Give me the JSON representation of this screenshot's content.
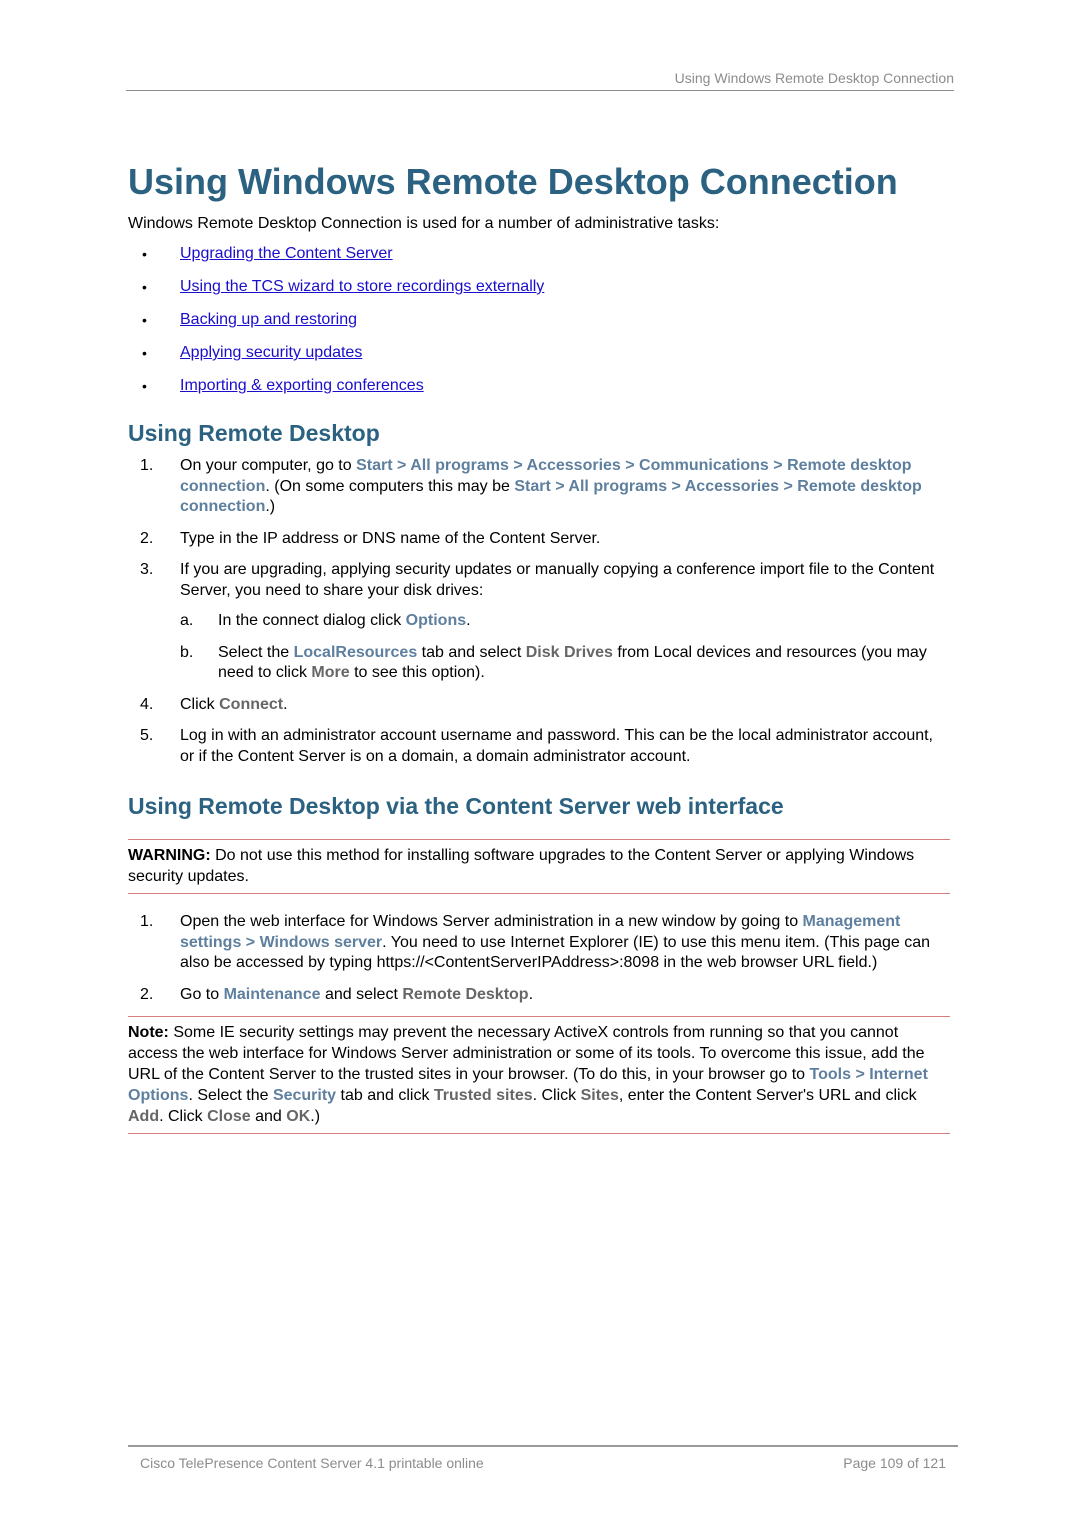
{
  "header": {
    "running_title": "Using Windows Remote Desktop Connection"
  },
  "title": "Using Windows Remote Desktop Connection",
  "intro": "Windows Remote Desktop Connection is used for a number of administrative tasks:",
  "bullet_glyph": "•",
  "links": [
    "Upgrading the Content Server",
    "Using the TCS wizard to store recordings externally",
    "Backing up and restoring",
    "Applying security updates",
    "Importing & exporting conferences"
  ],
  "section1": {
    "heading": "Using Remote Desktop",
    "steps": [
      {
        "num": "1.",
        "t1": "On your computer, go to ",
        "ui1": "Start > All programs > Accessories > Communications > Remote desktop connection",
        "t2": ". (On some computers this may be ",
        "ui2": "Start > All programs > Accessories > Remote desktop connection",
        "t3": ".)"
      },
      {
        "num": "2.",
        "text": "Type in the IP address or DNS name of the Content Server."
      },
      {
        "num": "3.",
        "text": "If you are upgrading, applying security updates or manually copying a conference import file to the Content Server, you need to share your disk drives:",
        "sub": [
          {
            "num": "a.",
            "t1": "In the connect dialog click ",
            "ui1": "Options",
            "t2": "."
          },
          {
            "num": "b.",
            "t1": "Select the ",
            "ui1": "LocalResources",
            "t2": " tab and select ",
            "ui2": "Disk Drives",
            "t3": " from Local devices and resources (you may need to click ",
            "ui3": "More",
            "t4": " to see this option)."
          }
        ]
      },
      {
        "num": "4.",
        "t1": "Click ",
        "ui1": "Connect",
        "t2": "."
      },
      {
        "num": "5.",
        "text": "Log in with an administrator account username and password.  This can be the local administrator account, or if the Content Server is on a domain, a domain administrator account."
      }
    ]
  },
  "section2": {
    "heading": "Using Remote Desktop via the Content Server web interface",
    "warning": {
      "label": "WARNING:",
      "text": " Do not use this method for installing software upgrades to the Content Server or applying Windows security updates."
    },
    "steps": [
      {
        "num": "1.",
        "t1": "Open the web interface for Windows Server administration in a new window by going to ",
        "ui1": "Management settings > Windows server",
        "t2": ". You need to use Internet Explorer (IE) to use this menu item. (This page can also be accessed by typing https://<ContentServerIPAddress>:8098 in the web browser URL field.)"
      },
      {
        "num": "2.",
        "t1": "Go to ",
        "ui1": "Maintenance",
        "t2": " and select ",
        "ui2": "Remote Desktop",
        "t3": "."
      }
    ],
    "note": {
      "label": "Note:",
      "t1": " Some IE security settings may prevent the necessary ActiveX controls from running so that you cannot access the web interface for Windows Server administration or some of its tools. To overcome this issue, add the URL of the Content Server to the trusted sites in your browser. (To do this, in your browser go to ",
      "ui1": "Tools > Internet Options",
      "t2": ". Select the ",
      "ui2": "Security",
      "t3": " tab and click ",
      "ui3": "Trusted sites",
      "t4": ". Click ",
      "ui4": "Sites",
      "t5": ", enter the Content Server's URL and click ",
      "ui5": "Add",
      "t6": ". Click ",
      "ui6": "Close",
      "t7": " and ",
      "ui7": "OK",
      "t8": ".)"
    }
  },
  "footer": {
    "left": "Cisco TelePresence Content Server 4.1 printable online",
    "right": "Page 109 of 121"
  }
}
